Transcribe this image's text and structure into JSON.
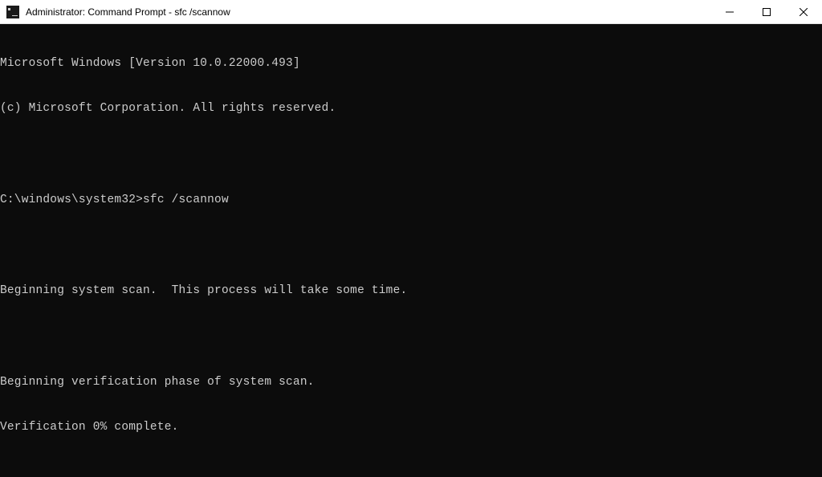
{
  "titlebar": {
    "title": "Administrator: Command Prompt - sfc  /scannow"
  },
  "terminal": {
    "lines": [
      "Microsoft Windows [Version 10.0.22000.493]",
      "(c) Microsoft Corporation. All rights reserved.",
      "",
      "C:\\windows\\system32>sfc /scannow",
      "",
      "Beginning system scan.  This process will take some time.",
      "",
      "Beginning verification phase of system scan.",
      "Verification 0% complete."
    ]
  }
}
